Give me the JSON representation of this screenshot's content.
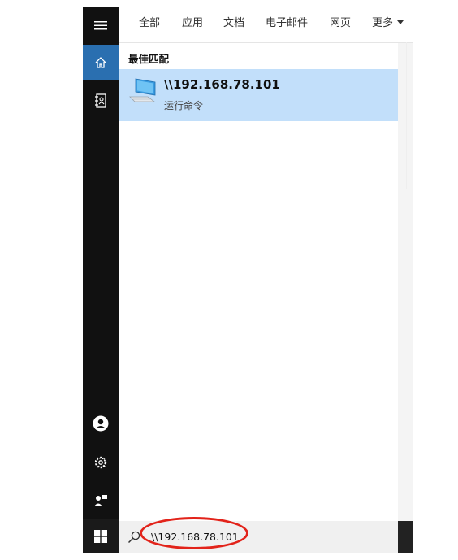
{
  "tabs": [
    "全部",
    "应用",
    "文档",
    "电子邮件",
    "网页",
    "更多"
  ],
  "section_title": "最佳匹配",
  "best_match": {
    "name": "\\\\192.168.78.101",
    "subtitle": "运行命令",
    "icon": "computer-icon"
  },
  "search": {
    "value": "\\\\192.168.78.101",
    "icon": "search-icon"
  },
  "sidebar": {
    "icons": [
      "hamburger-menu-icon",
      "home-icon",
      "notebook-icon",
      "user-icon",
      "settings-icon",
      "feedback-icon",
      "windows-start-icon"
    ]
  },
  "colors": {
    "sidebar_bg": "#111111",
    "active_bg": "#2a6fb0",
    "highlight_bg": "#c2dffa",
    "annotation_red": "#e2231a"
  }
}
